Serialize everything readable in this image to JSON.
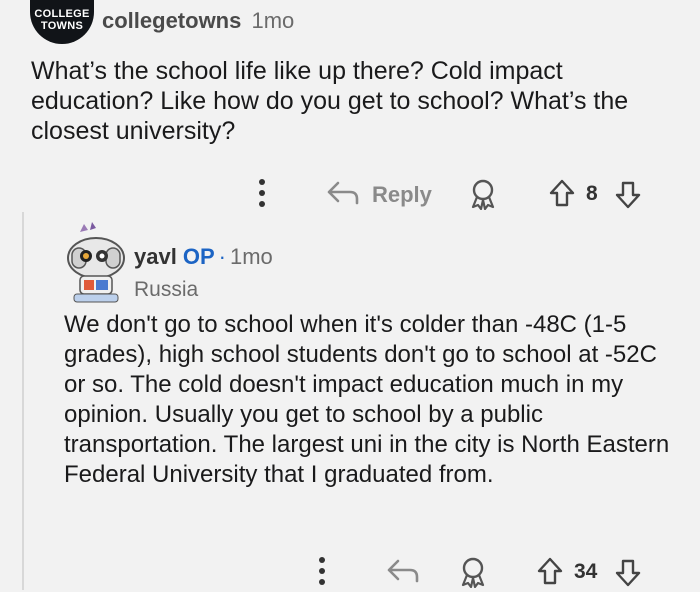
{
  "comment1": {
    "avatar_line1": "COLLEGE",
    "avatar_line2": "TOWNS",
    "username": "collegetowns",
    "time": "1mo",
    "body": "What’s the school life like up there? Cold impact education? Like how do you get to school? What’s the closest university?",
    "actions": {
      "reply_label": "Reply",
      "votes": "8"
    }
  },
  "comment2": {
    "username": "yavl",
    "op_badge": "OP",
    "separator": "·",
    "time": "1mo",
    "flair": "Russia",
    "body": "We don't go to school when it's colder than -48C (1-5 grades), high school students don't go to school at -52C or so. The cold doesn't impact education much in my opinion. Usually you get to school by a public transportation. The largest uni in the city is North Eastern Federal University that I graduated from.",
    "actions": {
      "votes": "34"
    }
  },
  "icons": {
    "more": "more-dots-icon",
    "reply": "reply-arrow-icon",
    "award": "award-icon",
    "upvote": "upvote-arrow-icon",
    "downvote": "downvote-arrow-icon"
  },
  "colors": {
    "background": "#f2f2f2",
    "op_blue": "#1c64c4",
    "muted": "#8a8a8a"
  }
}
